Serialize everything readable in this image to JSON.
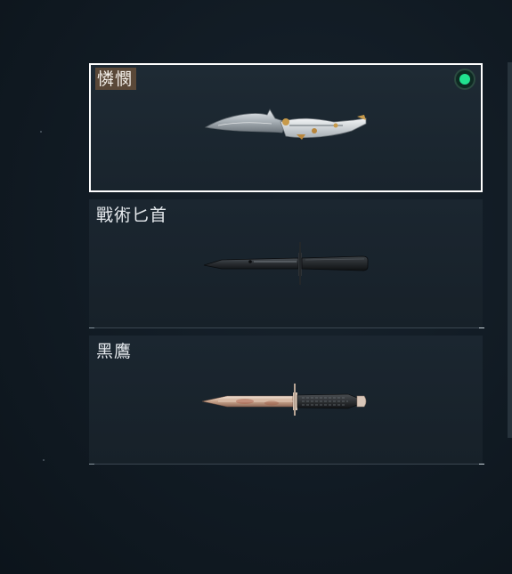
{
  "knives": [
    {
      "name": "憐憫",
      "selected": true,
      "equipped": true
    },
    {
      "name": "戰術匕首",
      "selected": false,
      "equipped": false
    },
    {
      "name": "黑鷹",
      "selected": false,
      "equipped": false
    }
  ],
  "icons": {
    "equipped": "green-dot-icon",
    "knife_1": "karambit-knife-icon",
    "knife_2": "tactical-dagger-icon",
    "knife_3": "black-hawk-dagger-icon"
  },
  "colors": {
    "equipped_indicator": "#21e28f",
    "selected_border": "#ffffff",
    "selected_label_bg": "#5a4838"
  }
}
